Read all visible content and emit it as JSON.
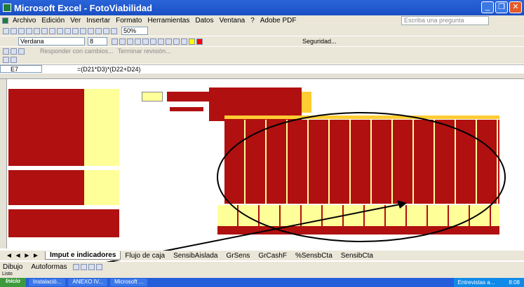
{
  "window": {
    "title": "Microsoft Excel - FotoViabilidad"
  },
  "menu": [
    "Archivo",
    "Edición",
    "Ver",
    "Insertar",
    "Formato",
    "Herramientas",
    "Datos",
    "Ventana",
    "?",
    "Adobe PDF"
  ],
  "help_placeholder": "Escriba una pregunta",
  "toolbar": {
    "zoom": "50%",
    "font": "Verdana",
    "font_size": "8",
    "security": "Seguridad...",
    "reply": "Responder con cambios...",
    "end_review": "Terminar revisión..."
  },
  "formula": {
    "cell": "E7",
    "value": "=(D21*D3)*(D22+D24)"
  },
  "tabs": [
    "Imput e indicadores",
    "Flujo de caja",
    "SensibAislada",
    "GrSens",
    "GrCashF",
    "%SensbCta",
    "SensibCta"
  ],
  "drawing": {
    "draw": "Dibujo",
    "autoshapes": "Autoformas"
  },
  "status": "Listo",
  "taskbar": {
    "start": "Inicio",
    "tasks": [
      "Instalació...",
      "ANEXO IV...",
      "Microsoft ..."
    ],
    "tray_label": "Entrevistas a...",
    "time": "8:08"
  },
  "colors": {
    "title_blue": "#1a4fc4",
    "red_block": "#b01010",
    "yellow": "#ffff99",
    "orange": "#ffcc33"
  }
}
